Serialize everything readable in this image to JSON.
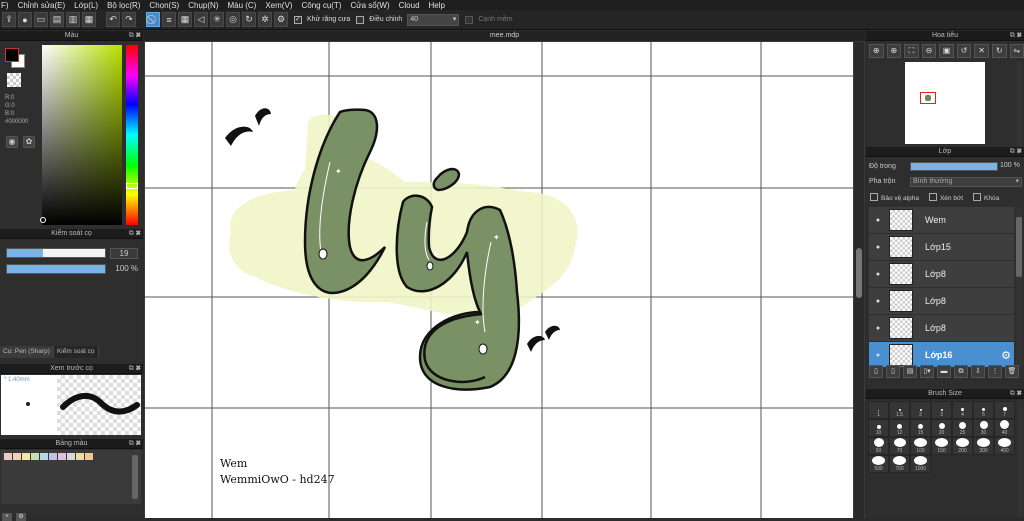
{
  "menu": [
    "F)",
    "Chỉnh sửa(E)",
    "Lớp(L)",
    "Bộ lọc(R)",
    "Chọn(S)",
    "Chụp(N)",
    "Màu (C)",
    "Xem(V)",
    "Công cụ(T)",
    "Cửa sổ(W)",
    "Cloud",
    "Help"
  ],
  "toolbar": {
    "antialias_label": "Khử răng cưa",
    "correction_label": "Điều chỉnh",
    "correction_value": "40",
    "edge_label": "Cạnh mềm"
  },
  "color_panel": {
    "title": "Màu",
    "r": "R:0",
    "g": "G:0",
    "b": "B:0",
    "hex": "#000000",
    "fg": "#000000",
    "bg": "#ffffff",
    "hue_color": "#b8e000"
  },
  "brush_control": {
    "title": "Kiểm soát cọ",
    "size_value": "19",
    "size_fraction": 0.37,
    "opacity_value": "100 %",
    "opacity_fraction": 1.0,
    "tab_brush": "Cọ: Pen (Sharp)",
    "tab_control": "Kiểm soát cọ"
  },
  "brush_preview": {
    "title": "Xem trước cọ",
    "size": "* 1.40mm"
  },
  "palette": {
    "title": "Bảng màu",
    "swatches": [
      "#f2c6c6",
      "#f4d2b8",
      "#f0e6b0",
      "#c8e0b0",
      "#b8d8e8",
      "#c0c0e8",
      "#e0c0e0",
      "#d8d8d8",
      "#e8e0a0",
      "#f0c890"
    ]
  },
  "document": {
    "title": "mee.mdp",
    "credit_line1": "Wem",
    "credit_line2": "WemmiOwO - hd247",
    "art_colors": {
      "fill": "#7a9165",
      "shadow": "#f0f5c8",
      "outline": "#111111"
    }
  },
  "navigator": {
    "title": "Hoa tiêu"
  },
  "layer_panel": {
    "title": "Lớp",
    "opacity_label": "Độ trong",
    "opacity_value": "100 %",
    "blend_label": "Pha trộn",
    "blend_value": "Bình thường",
    "protect_alpha": "Bảo vệ alpha",
    "clipping": "Xén bớt",
    "lock": "Khóa",
    "layers": [
      {
        "name": "Wem",
        "selected": false
      },
      {
        "name": "Lớp15",
        "selected": false
      },
      {
        "name": "Lớp8",
        "selected": false
      },
      {
        "name": "Lớp8",
        "selected": false
      },
      {
        "name": "Lớp8",
        "selected": false
      },
      {
        "name": "Lớp16",
        "selected": true
      }
    ]
  },
  "brush_size": {
    "title": "Brush Size",
    "sizes": [
      "1",
      "1.5",
      "2",
      "3",
      "4",
      "5",
      "7",
      "10",
      "12",
      "15",
      "20",
      "25",
      "30",
      "40",
      "50",
      "70",
      "100",
      "150",
      "200",
      "300",
      "400",
      "500",
      "700",
      "1000"
    ]
  }
}
